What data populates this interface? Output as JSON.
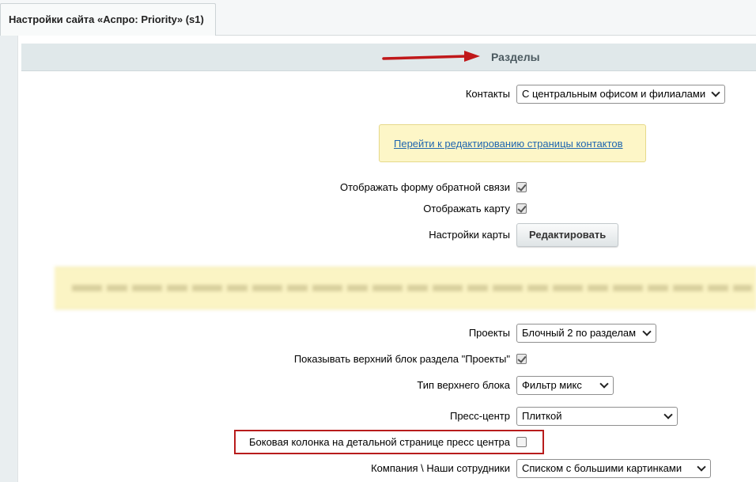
{
  "tab": {
    "title": "Настройки сайта «Аспро: Priority» (s1)"
  },
  "section": {
    "title": "Разделы"
  },
  "contacts": {
    "label": "Контакты",
    "value": "С центральным офисом и филиалами",
    "link": "Перейти к редактированию страницы контактов"
  },
  "feedback_form": {
    "label": "Отображать форму обратной связи",
    "checked": true
  },
  "show_map": {
    "label": "Отображать карту",
    "checked": true
  },
  "map_settings": {
    "label": "Настройки карты",
    "button": "Редактировать"
  },
  "projects": {
    "label": "Проекты",
    "value": "Блочный 2 по разделам"
  },
  "projects_top": {
    "label": "Показывать верхний блок раздела \"Проекты\"",
    "checked": true
  },
  "top_block_type": {
    "label": "Тип верхнего блока",
    "value": "Фильтр микс"
  },
  "press": {
    "label": "Пресс-центр",
    "value": "Плиткой"
  },
  "press_sidebar": {
    "label": "Боковая колонка на детальной странице пресс центра",
    "checked": false
  },
  "company": {
    "label": "Компания \\ Наши сотрудники",
    "value": "Списком с большими картинками"
  },
  "colors": {
    "arrow": "#c0181a",
    "highlight": "#b81c1c",
    "link": "#2067b0"
  }
}
